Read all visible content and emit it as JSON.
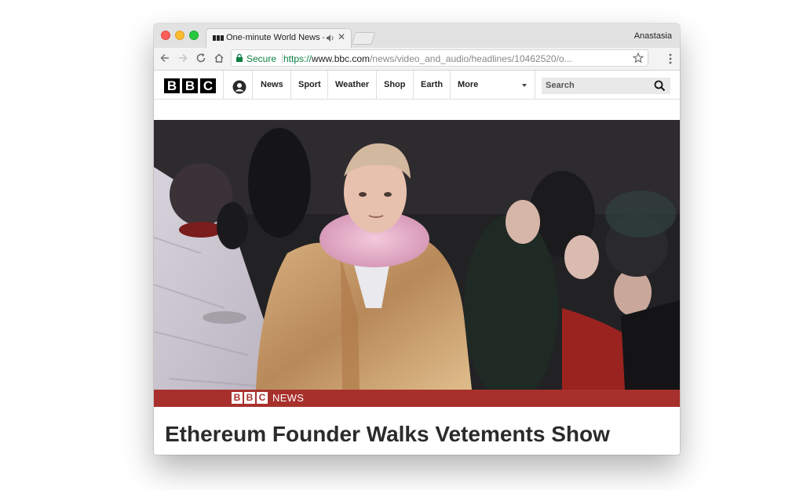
{
  "browser": {
    "tab": {
      "title": "One-minute World News - BBC News"
    },
    "profile_name": "Anastasia",
    "address_bar": {
      "secure_label": "Secure",
      "scheme": "https://",
      "host": "www.bbc.com",
      "path": "/news/video_and_audio/headlines/10462520/o..."
    }
  },
  "bbc": {
    "logo_letters": [
      "B",
      "B",
      "C"
    ],
    "nav_items": [
      "News",
      "Sport",
      "Weather",
      "Shop",
      "Earth",
      "More"
    ],
    "search_placeholder": "Search"
  },
  "video": {
    "banner_logo": [
      "B",
      "B",
      "C"
    ],
    "banner_text": "NEWS"
  },
  "headline": "Ethereum Founder Walks Vetements Show",
  "colors": {
    "secure_green": "#0b8043",
    "bbc_news_red": "#a8302c"
  }
}
